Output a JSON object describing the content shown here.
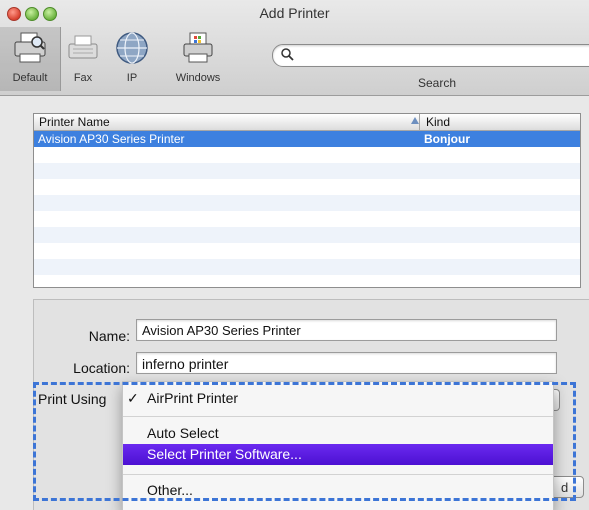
{
  "window": {
    "title": "Add Printer"
  },
  "toolbar": {
    "items": [
      {
        "label": "Default",
        "icon": "default-printer-icon"
      },
      {
        "label": "Fax",
        "icon": "fax-icon"
      },
      {
        "label": "IP",
        "icon": "ip-globe-icon"
      },
      {
        "label": "Windows",
        "icon": "windows-printer-icon"
      }
    ],
    "search": {
      "label": "Search",
      "value": "",
      "placeholder": ""
    }
  },
  "printer_list": {
    "columns": [
      "Printer Name",
      "Kind"
    ],
    "sort_indicator": "ascending",
    "rows": [
      {
        "name": "Avision AP30 Series Printer",
        "kind": "Bonjour",
        "selected": true
      }
    ]
  },
  "form": {
    "name_label": "Name:",
    "name_value": "Avision AP30 Series Printer",
    "location_label": "Location:",
    "location_value": "inferno printer",
    "print_using_label": "Print Using"
  },
  "print_using_menu": {
    "items": [
      {
        "label": "AirPrint Printer",
        "checked": true,
        "check_mark": "✓"
      },
      {
        "label": "Auto Select",
        "checked": false
      },
      {
        "label": "Select Printer Software...",
        "checked": false,
        "highlighted": true
      },
      {
        "label": "Other...",
        "checked": false
      }
    ]
  },
  "add_button": {
    "label": "d"
  },
  "colors": {
    "selection": "#3d80df",
    "menu_highlight": "#5a1ce0",
    "focus_dash": "#3d75d6",
    "window_bg": "#e8e8e8"
  }
}
